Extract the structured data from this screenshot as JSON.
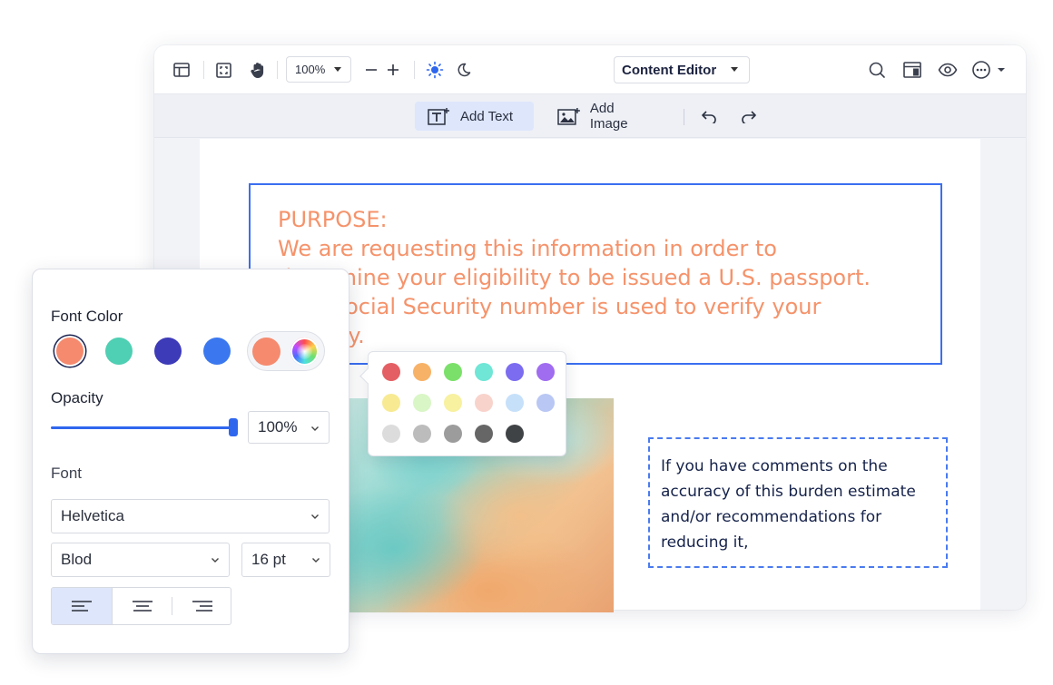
{
  "toolbar": {
    "zoom": "100%",
    "mode": "Content Editor"
  },
  "subtoolbar": {
    "add_text": "Add Text",
    "add_image": "Add Image"
  },
  "document": {
    "purpose_lines": [
      "PURPOSE:",
      "We are requesting this information in order to",
      "determine your eligibility to be issued a U.S. passport.",
      "Your Social Security number is used to verify your",
      "identity."
    ],
    "comment_lines": [
      "If you have comments on the",
      "accuracy of this burden estimate",
      "and/or recommendations for",
      "reducing it,"
    ]
  },
  "swatches": {
    "rows": [
      [
        "#e45f63",
        "#f7b267",
        "#7be06a",
        "#6fe6d6",
        "#7b6cf0",
        "#a06cf0"
      ],
      [
        "#f7ea92",
        "#d9f6c6",
        "#f7f1a0",
        "#f8d3cc",
        "#c6e0fa",
        "#b9c7f4"
      ],
      [
        "#dcdcdc",
        "#bcbcbc",
        "#9c9c9c",
        "#666666",
        "#404346"
      ]
    ]
  },
  "panel": {
    "font_color_label": "Font Color",
    "colors": [
      "#f58a6e",
      "#4fcfb3",
      "#3e3bb8",
      "#3b78ef"
    ],
    "selected_color": "#f58a6e",
    "custom_color": "#f58a6e",
    "opacity_label": "Opacity",
    "opacity_value": "100%",
    "opacity_level": 1.0,
    "font_label": "Font",
    "font_family": "Helvetica",
    "font_weight": "Blod",
    "font_size": "16 pt",
    "alignment": "left"
  }
}
